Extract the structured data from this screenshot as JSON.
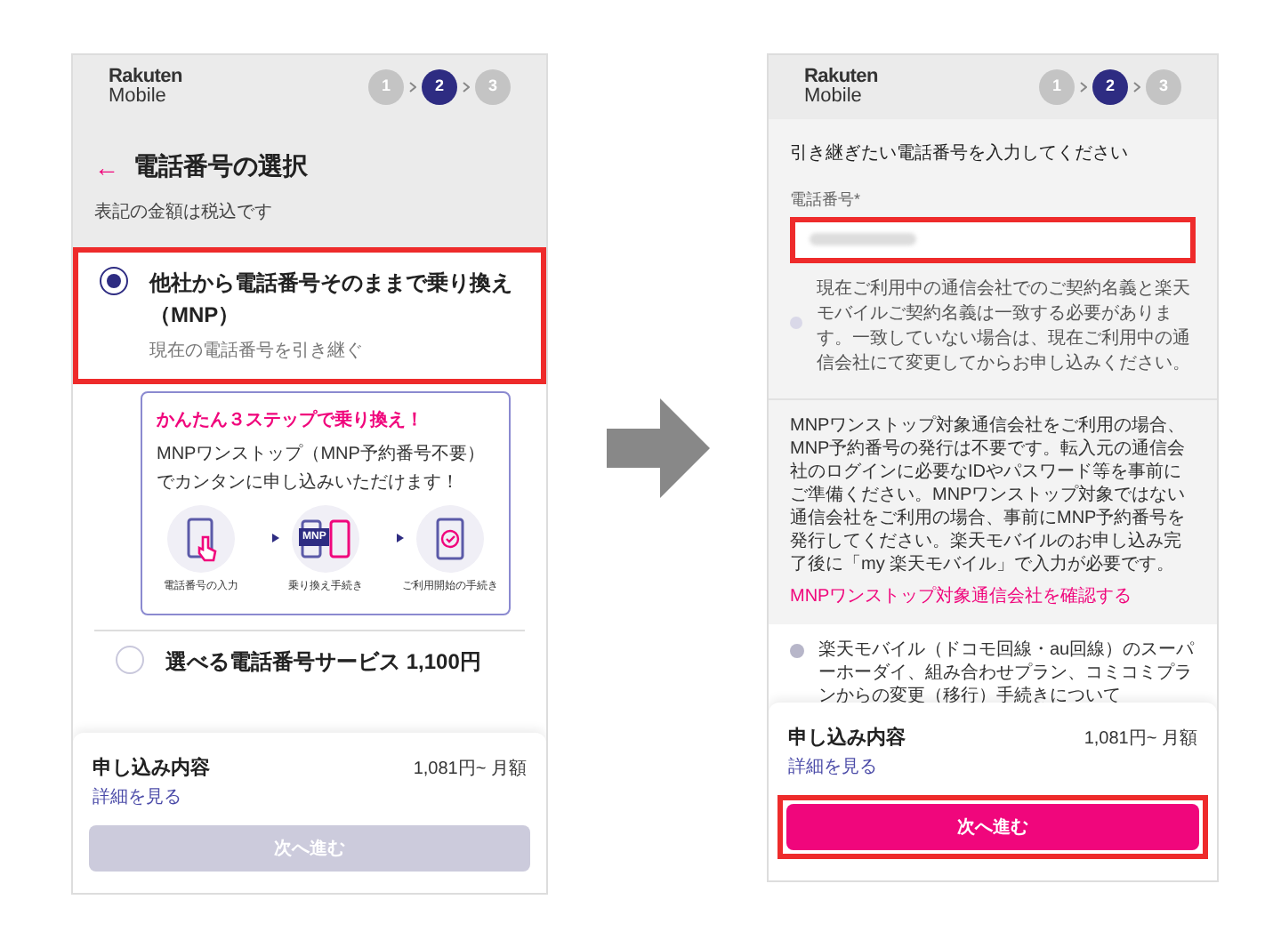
{
  "left": {
    "logo": [
      "Rakuten",
      "Mobile"
    ],
    "steps": [
      {
        "label": "1",
        "selected": false
      },
      {
        "label": "2",
        "selected": true
      },
      {
        "label": "3",
        "selected": false
      }
    ],
    "back": "←",
    "title": "電話番号の選択",
    "tax_note": "表記の金額は税込です",
    "options": [
      {
        "title": "他社から電話番号そのままで乗り換え（MNP）",
        "subtitle": "現在の電話番号を引き継ぐ",
        "selected": true,
        "highlighted": true,
        "promo": {
          "heading": "かんたん３ステップで乗り換え！",
          "text": "MNPワンストップ（MNP予約番号不要）でカンタンに申し込みいただけます！",
          "steps": [
            {
              "kind": "tap",
              "label": "電話番号の入力"
            },
            {
              "kind": "transfer",
              "badge": "MNP",
              "label": "乗り換え手続き"
            },
            {
              "kind": "check",
              "label": "ご利用開始の手続き"
            }
          ]
        }
      },
      {
        "title": "選べる電話番号サービス 1,100円",
        "selected": false,
        "highlighted": false
      }
    ],
    "summary": {
      "title": "申し込み内容",
      "price": "1,081円~ 月額",
      "link": "詳細を見る"
    },
    "next": {
      "label": "次へ進む",
      "disabled": true,
      "highlighted": false
    }
  },
  "right": {
    "logo": [
      "Rakuten",
      "Mobile"
    ],
    "steps": [
      {
        "label": "1",
        "selected": false
      },
      {
        "label": "2",
        "selected": true
      },
      {
        "label": "3",
        "selected": false
      }
    ],
    "instruction": "引き継ぎたい電話番号を入力してください",
    "field": {
      "label": "電話番号*",
      "highlighted": true
    },
    "note": "現在ご利用中の通信会社でのご契約名義と楽天モバイルご契約名義は一致する必要があります。一致していない場合は、現在ご利用中の通信会社にて変更してからお申し込みください。",
    "mnp_info": "MNPワンストップ対象通信会社をご利用の場合、MNP予約番号の発行は不要です。転入元の通信会社のログインに必要なIDやパスワード等を事前にご準備ください。MNPワンストップ対象ではない通信会社をご利用の場合、事前にMNP予約番号を発行してください。楽天モバイルのお申し込み完了後に「my 楽天モバイル」で入力が必要です。",
    "mnp_link": "MNPワンストップ対象通信会社を確認する",
    "info": "楽天モバイル（ドコモ回線・au回線）のスーパーホーダイ、組み合わせプラン、コミコミプランからの変更（移行）手続きについて",
    "summary": {
      "title": "申し込み内容",
      "price": "1,081円~ 月額",
      "link": "詳細を見る"
    },
    "next": {
      "label": "次へ進む",
      "disabled": false,
      "highlighted": true
    }
  }
}
